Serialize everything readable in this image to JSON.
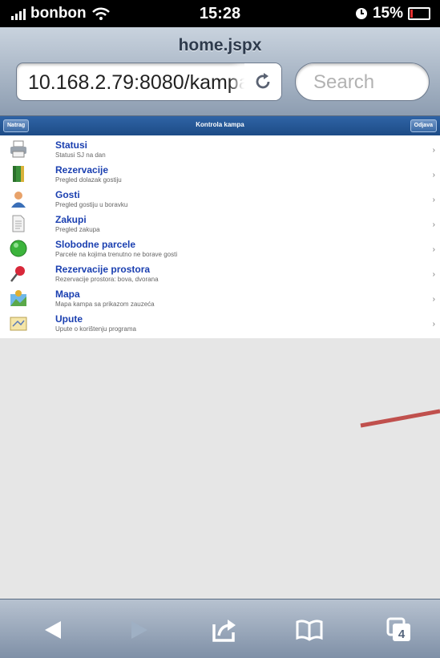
{
  "status_bar": {
    "carrier": "bonbon",
    "time": "15:28",
    "battery": "15%",
    "battery_level": 0.15
  },
  "browser": {
    "page_title": "home.jspx",
    "url": "10.168.2.79:8080/kampa",
    "search_placeholder": "Search",
    "tabs_count": "4"
  },
  "app_header": {
    "left_button": "Natrag",
    "title": "Kontrola kampa",
    "right_button": "Odjava"
  },
  "menu": [
    {
      "icon": "printer-icon",
      "title": "Statusi",
      "desc": "Statusi SJ na dan"
    },
    {
      "icon": "book-icon",
      "title": "Rezervacije",
      "desc": "Pregled dolazak gostiju"
    },
    {
      "icon": "person-icon",
      "title": "Gosti",
      "desc": "Pregled gostiju u boravku"
    },
    {
      "icon": "document-icon",
      "title": "Zakupi",
      "desc": "Pregled zakupa"
    },
    {
      "icon": "green-circle-icon",
      "title": "Slobodne parcele",
      "desc": "Parcele na kojima trenutno ne borave gosti"
    },
    {
      "icon": "pin-icon",
      "title": "Rezervacije prostora",
      "desc": "Rezervacije prostora: bova, dvorana"
    },
    {
      "icon": "map-icon",
      "title": "Mapa",
      "desc": "Mapa kampa sa prikazom zauzeća"
    },
    {
      "icon": "help-icon",
      "title": "Upute",
      "desc": "Upute o korištenju programa"
    }
  ],
  "colors": {
    "link": "#1a3fb0",
    "header": "#1d4b86",
    "annotation": "#c0504d"
  }
}
